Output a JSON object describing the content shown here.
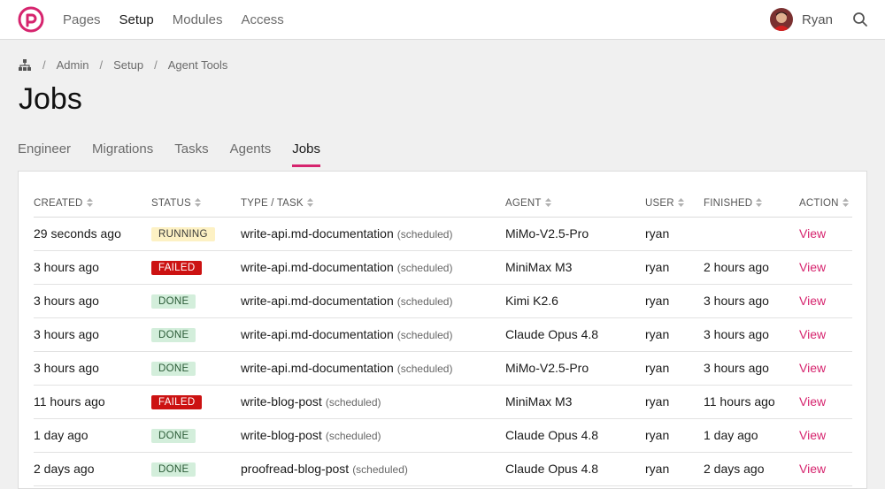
{
  "nav": {
    "items": [
      {
        "label": "Pages",
        "active": false
      },
      {
        "label": "Setup",
        "active": true
      },
      {
        "label": "Modules",
        "active": false
      },
      {
        "label": "Access",
        "active": false
      }
    ]
  },
  "user": {
    "name": "Ryan"
  },
  "breadcrumb": {
    "items": [
      "Admin",
      "Setup",
      "Agent Tools"
    ]
  },
  "page": {
    "title": "Jobs"
  },
  "tabs": [
    {
      "label": "Engineer",
      "active": false
    },
    {
      "label": "Migrations",
      "active": false
    },
    {
      "label": "Tasks",
      "active": false
    },
    {
      "label": "Agents",
      "active": false
    },
    {
      "label": "Jobs",
      "active": true
    }
  ],
  "table": {
    "columns": [
      "CREATED",
      "STATUS",
      "TYPE / TASK",
      "AGENT",
      "USER",
      "FINISHED",
      "ACTION"
    ],
    "rows": [
      {
        "created": "29 seconds ago",
        "status": "RUNNING",
        "task": "write-api.md-documentation",
        "tag": "(scheduled)",
        "agent": "MiMo-V2.5-Pro",
        "user": "ryan",
        "finished": "",
        "action": "View"
      },
      {
        "created": "3 hours ago",
        "status": "FAILED",
        "task": "write-api.md-documentation",
        "tag": "(scheduled)",
        "agent": "MiniMax M3",
        "user": "ryan",
        "finished": "2 hours ago",
        "action": "View"
      },
      {
        "created": "3 hours ago",
        "status": "DONE",
        "task": "write-api.md-documentation",
        "tag": "(scheduled)",
        "agent": "Kimi K2.6",
        "user": "ryan",
        "finished": "3 hours ago",
        "action": "View"
      },
      {
        "created": "3 hours ago",
        "status": "DONE",
        "task": "write-api.md-documentation",
        "tag": "(scheduled)",
        "agent": "Claude Opus 4.8",
        "user": "ryan",
        "finished": "3 hours ago",
        "action": "View"
      },
      {
        "created": "3 hours ago",
        "status": "DONE",
        "task": "write-api.md-documentation",
        "tag": "(scheduled)",
        "agent": "MiMo-V2.5-Pro",
        "user": "ryan",
        "finished": "3 hours ago",
        "action": "View"
      },
      {
        "created": "11 hours ago",
        "status": "FAILED",
        "task": "write-blog-post",
        "tag": "(scheduled)",
        "agent": "MiniMax M3",
        "user": "ryan",
        "finished": "11 hours ago",
        "action": "View"
      },
      {
        "created": "1 day ago",
        "status": "DONE",
        "task": "write-blog-post",
        "tag": "(scheduled)",
        "agent": "Claude Opus 4.8",
        "user": "ryan",
        "finished": "1 day ago",
        "action": "View"
      },
      {
        "created": "2 days ago",
        "status": "DONE",
        "task": "proofread-blog-post",
        "tag": "(scheduled)",
        "agent": "Claude Opus 4.8",
        "user": "ryan",
        "finished": "2 days ago",
        "action": "View"
      }
    ]
  },
  "colors": {
    "accent": "#d6246e",
    "failed": "#cc1212",
    "running_bg": "#fdf1c4",
    "done_bg": "#d3eedb"
  }
}
